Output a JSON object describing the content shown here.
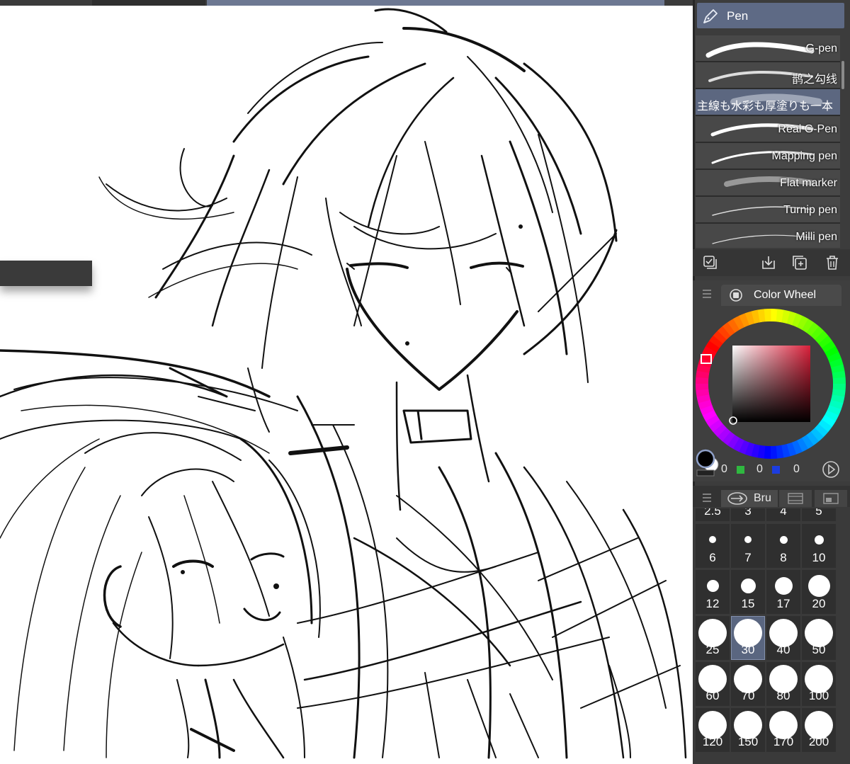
{
  "panel": {
    "pen_header": "Pen",
    "brushes": [
      {
        "name": "G-pen",
        "selected": false
      },
      {
        "name": "鹊之勾线",
        "selected": false
      },
      {
        "name": "主線も水彩も厚塗りも一本",
        "selected": true
      },
      {
        "name": "Real G-Pen",
        "selected": false
      },
      {
        "name": "Mapping pen",
        "selected": false
      },
      {
        "name": "Flat marker",
        "selected": false
      },
      {
        "name": "Turnip pen",
        "selected": false
      },
      {
        "name": "Milli pen",
        "selected": false
      }
    ],
    "brush_toolbar_icons": [
      "copy-settings-icon",
      "import-icon",
      "add-brush-icon",
      "trash-icon"
    ]
  },
  "color_wheel": {
    "tab_label": "Color Wheel",
    "rgb": {
      "r": "0",
      "g": "0",
      "b": "0"
    },
    "colors": {
      "main": "#000000",
      "sub": "#ffffff",
      "hue": "#d9203a",
      "accent": "#5e6a85"
    }
  },
  "brush_size": {
    "tab_label": "Bru",
    "partial_row": [
      "2.5",
      "3",
      "4",
      "5"
    ],
    "sizes": [
      "6",
      "7",
      "8",
      "10",
      "12",
      "15",
      "17",
      "20",
      "25",
      "30",
      "40",
      "50",
      "60",
      "70",
      "80",
      "100",
      "120",
      "150",
      "170",
      "200"
    ],
    "selected": "30"
  }
}
